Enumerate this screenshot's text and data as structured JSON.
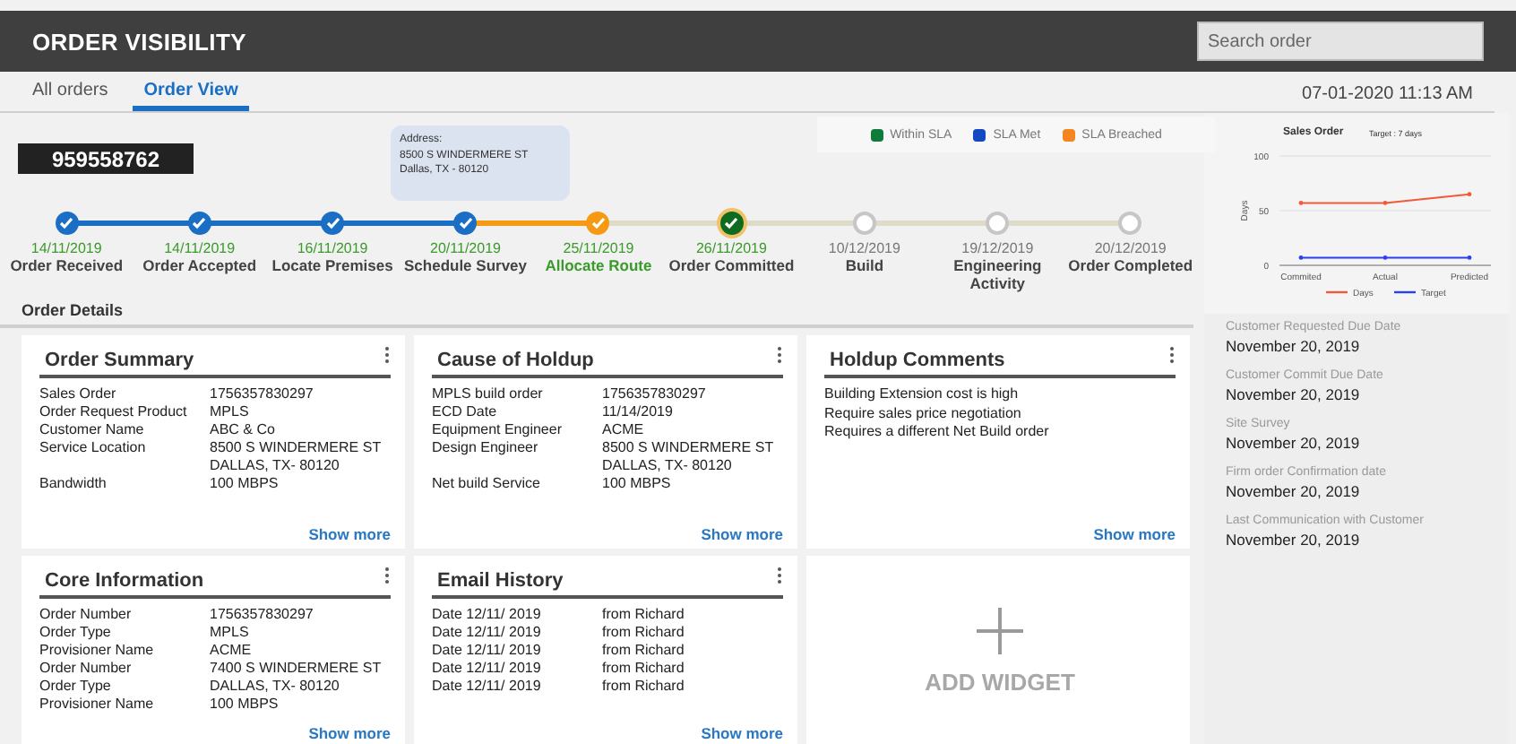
{
  "header": {
    "title": "ORDER VISIBILITY",
    "search": {
      "placeholder": "Search order"
    }
  },
  "tabs": [
    {
      "label": "All orders",
      "selected": false
    },
    {
      "label": "Order View",
      "selected": true
    }
  ],
  "timestamp": "07-01-2020 11:13 AM",
  "order_number": "959558762",
  "address_tooltip": [
    "Address:",
    "8500 S WINDERMERE ST",
    "Dallas, TX - 80120"
  ],
  "legend": [
    {
      "label": "Within SLA",
      "color": "#0f7b3a"
    },
    {
      "label": "SLA Met",
      "color": "#1447c2"
    },
    {
      "label": "SLA Breached",
      "color": "#f5861f"
    }
  ],
  "steps": [
    {
      "kind": "met",
      "date": "14/11/2019",
      "label": "Order Received",
      "highlighted": false
    },
    {
      "kind": "met",
      "date": "14/11/2019",
      "label": "Order Accepted",
      "highlighted": false
    },
    {
      "kind": "met",
      "date": "16/11/2019",
      "label": "Locate Premises",
      "highlighted": false
    },
    {
      "kind": "met",
      "date": "20/11/2019",
      "label": "Schedule Survey",
      "highlighted": false
    },
    {
      "kind": "breached",
      "date": "25/11/2019",
      "label": "Allocate Route",
      "highlighted": true
    },
    {
      "kind": "within",
      "date": "26/11/2019",
      "label": "Order Committed",
      "highlighted": false
    },
    {
      "kind": "pending",
      "date": "10/12/2019",
      "label": "Build",
      "highlighted": false
    },
    {
      "kind": "pending",
      "date": "19/12/2019",
      "label": "Engineering Activity",
      "highlighted": false
    },
    {
      "kind": "pending",
      "date": "20/12/2019",
      "label": "Order Completed",
      "highlighted": false
    }
  ],
  "section_title": "Order Details",
  "cards": [
    {
      "kind": "fields",
      "title": "Order Summary",
      "link": "Show more",
      "rows": [
        {
          "label": "Sales Order",
          "lines": [
            "1756357830297"
          ]
        },
        {
          "label": "Order Request Product",
          "lines": [
            "MPLS"
          ]
        },
        {
          "label": "Customer Name",
          "lines": [
            "ABC & Co"
          ]
        },
        {
          "label": "Service Location",
          "lines": [
            "8500 S WINDERMERE ST",
            "DALLAS, TX- 80120"
          ]
        },
        {
          "label": "Bandwidth",
          "lines": [
            "100 MBPS"
          ]
        }
      ]
    },
    {
      "kind": "fields",
      "title": "Cause of Holdup",
      "link": "Show more",
      "rows": [
        {
          "label": "MPLS build order",
          "lines": [
            "1756357830297"
          ]
        },
        {
          "label": "ECD Date",
          "lines": [
            "11/14/2019"
          ]
        },
        {
          "label": "Equipment Engineer",
          "lines": [
            "ACME"
          ]
        },
        {
          "label": "Design Engineer",
          "lines": [
            "8500 S WINDERMERE ST",
            "DALLAS, TX- 80120"
          ]
        },
        {
          "label": "Net build Service",
          "lines": [
            "100 MBPS"
          ]
        }
      ]
    },
    {
      "kind": "lines",
      "title": "Holdup Comments",
      "link": "Show more",
      "lines": [
        "Building Extension cost is high",
        "Require sales price negotiation",
        "Requires a different Net Build order"
      ]
    },
    {
      "kind": "fields",
      "title": "Core Information",
      "link": "Show more",
      "rows": [
        {
          "label": "Order  Number",
          "lines": [
            "1756357830297"
          ]
        },
        {
          "label": "Order Type",
          "lines": [
            "MPLS"
          ]
        },
        {
          "label": "Provisioner Name",
          "lines": [
            "ACME"
          ]
        },
        {
          "label": "Order Number",
          "lines": [
            "7400 S WINDERMERE ST"
          ]
        },
        {
          "label": "Order Type",
          "lines": [
            "DALLAS, TX- 80120"
          ]
        },
        {
          "label": "Provisioner Name",
          "lines": [
            "100 MBPS"
          ]
        }
      ]
    },
    {
      "kind": "fields",
      "title": "Email History",
      "link": "Show more",
      "rows": [
        {
          "label": "Date 12/11/ 2019",
          "lines": [
            "from Richard"
          ]
        },
        {
          "label": "Date 12/11/ 2019",
          "lines": [
            "from Richard"
          ]
        },
        {
          "label": "Date 12/11/ 2019",
          "lines": [
            "from Richard"
          ]
        },
        {
          "label": "Date 12/11/ 2019",
          "lines": [
            "from Richard"
          ]
        },
        {
          "label": "Date 12/11/ 2019",
          "lines": [
            "from Richard"
          ]
        }
      ]
    },
    {
      "kind": "add",
      "label": "ADD WIDGET"
    }
  ],
  "side": {
    "chart_data": {
      "type": "line",
      "title": "Sales Order",
      "ylabel": "Days",
      "categories": [
        "Commited",
        "Actual",
        "Predicted"
      ],
      "ylim": [
        0,
        100
      ],
      "yticks": [
        0,
        50,
        100
      ],
      "annotations": [
        "Target : 7 days"
      ],
      "legend": true,
      "series": [
        {
          "name": "Days",
          "color": "#f05a3a",
          "values": [
            57,
            57,
            65
          ]
        },
        {
          "name": "Target",
          "color": "#2b3ff2",
          "values": [
            7,
            7,
            7
          ]
        }
      ]
    },
    "dates": [
      {
        "label": "Customer Requested  Due Date",
        "value": "November 20, 2019"
      },
      {
        "label": "Customer Commit  Due Date",
        "value": "November 20, 2019"
      },
      {
        "label": "Site Survey",
        "value": "November 20, 2019"
      },
      {
        "label": "Firm order Confirmation date",
        "value": "November 20, 2019"
      },
      {
        "label": "Last Communication with Customer",
        "value": "November 20, 2019"
      }
    ]
  }
}
